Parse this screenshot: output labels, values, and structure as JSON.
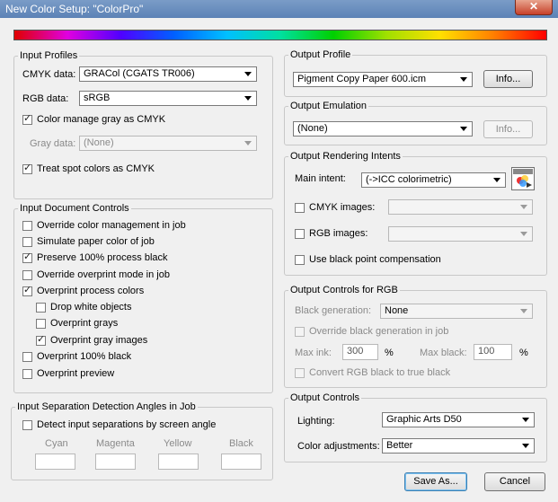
{
  "window": {
    "title": "New Color Setup: \"ColorPro\"",
    "close": "✕"
  },
  "input_profiles": {
    "title": "Input Profiles",
    "cmyk_label": "CMYK data:",
    "cmyk_value": "GRACol (CGATS TR006)",
    "rgb_label": "RGB data:",
    "rgb_value": "sRGB",
    "gray_cb": "Color manage gray as CMYK",
    "gray_label": "Gray data:",
    "gray_value": "(None)",
    "spot_cb": "Treat spot colors as CMYK"
  },
  "doc_controls": {
    "title": "Input Document Controls",
    "items": [
      "Override color management in job",
      "Simulate paper color of job",
      "Preserve 100% process black",
      "Override overprint mode in job",
      "Overprint process colors",
      "Drop white objects",
      "Overprint grays",
      "Overprint gray images",
      "Overprint 100% black",
      "Overprint preview"
    ]
  },
  "separation": {
    "title": "Input Separation Detection Angles in Job",
    "detect_cb": "Detect input separations by screen angle",
    "cyan": "Cyan",
    "magenta": "Magenta",
    "yellow": "Yellow",
    "black": "Black"
  },
  "output_profile": {
    "title": "Output Profile",
    "value": "Pigment Copy Paper 600.icm",
    "info": "Info..."
  },
  "output_emulation": {
    "title": "Output Emulation",
    "value": "(None)",
    "info": "Info..."
  },
  "rendering": {
    "title": "Output Rendering Intents",
    "main_label": "Main intent:",
    "main_value": "(->ICC colorimetric)",
    "cmyk_cb": "CMYK images:",
    "rgb_cb": "RGB images:",
    "bpc_cb": "Use black point compensation"
  },
  "rgb_controls": {
    "title": "Output Controls for RGB",
    "black_gen_label": "Black generation:",
    "black_gen_value": "None",
    "override_cb": "Override black generation in job",
    "max_ink_label": "Max ink:",
    "max_ink_value": "300",
    "pct1": "%",
    "max_black_label": "Max black:",
    "max_black_value": "100",
    "pct2": "%",
    "convert_cb": "Convert RGB black to true black"
  },
  "output_controls": {
    "title": "Output Controls",
    "lighting_label": "Lighting:",
    "lighting_value": "Graphic Arts D50",
    "adjust_label": "Color adjustments:",
    "adjust_value": "Better"
  },
  "buttons": {
    "save_as": "Save As...",
    "cancel": "Cancel"
  }
}
